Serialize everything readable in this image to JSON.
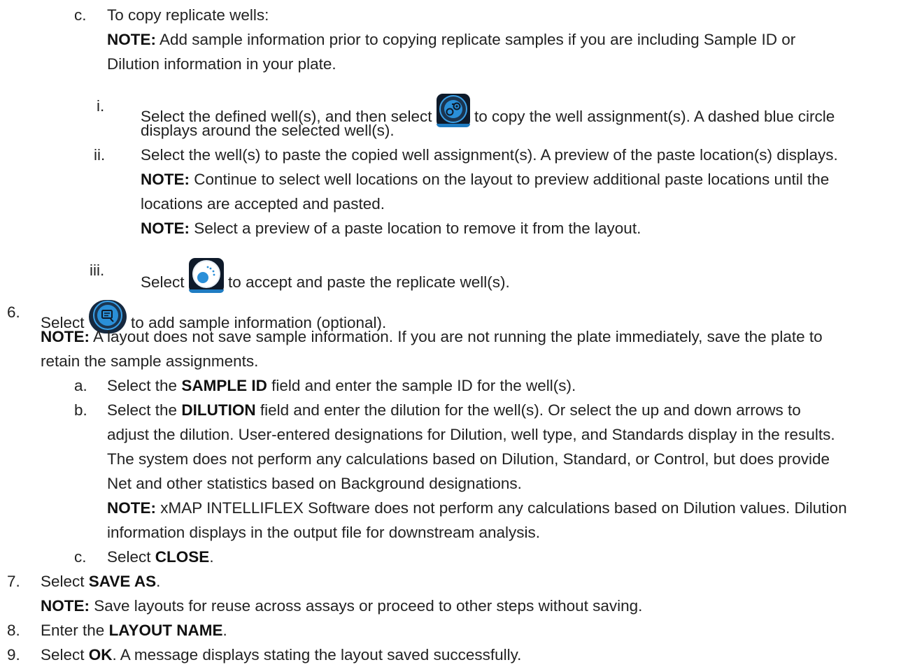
{
  "step_5c": {
    "marker": "c.",
    "title": "To copy replicate wells:",
    "note_label": "NOTE:",
    "note_text_1": " Add sample information prior to copying replicate samples if you are including Sample ID or",
    "note_text_2": "Dilution information in your plate.",
    "sub_i": {
      "marker": "i.",
      "text_before": "Select the defined well(s), and then select ",
      "icon": "copy-wells-icon",
      "text_after": " to copy the well assignment(s). A dashed blue circle",
      "text_line2": "displays around the selected well(s)."
    },
    "sub_ii": {
      "marker": "ii.",
      "text": "Select the well(s) to paste the copied well assignment(s). A preview of the paste location(s) displays.",
      "note1_label": "NOTE:",
      "note1_text_1": " Continue to select well locations on the layout to preview additional paste locations until the",
      "note1_text_2": "locations are accepted and pasted.",
      "note2_label": "NOTE:",
      "note2_text": " Select a preview of a paste location to remove it from the layout."
    },
    "sub_iii": {
      "marker": "iii.",
      "text_before": "Select ",
      "icon": "accept-paste-icon",
      "text_after": " to accept and paste the replicate well(s)."
    }
  },
  "step_6": {
    "marker": "6.",
    "text_before": "Select ",
    "icon": "sample-information-icon",
    "text_after": " to add sample information (optional).",
    "note_label": "NOTE:",
    "note_text_1": " A layout does not save sample information. If you are not running the plate immediately, save the plate to",
    "note_text_2": "retain the sample assignments.",
    "a": {
      "marker": "a.",
      "text_1": "Select the ",
      "bold": "SAMPLE ID",
      "text_2": " field and enter the sample ID for the well(s)."
    },
    "b": {
      "marker": "b.",
      "text_1": "Select the ",
      "bold": "DILUTION",
      "text_2": " field and enter the dilution for the well(s). Or select the up and down arrows to",
      "line2": "adjust the dilution. User-entered designations for Dilution, well type, and Standards display in the results.",
      "line3": "The system does not perform any calculations based on Dilution, Standard, or Control, but does provide",
      "line4": "Net and other statistics based on Background designations.",
      "note_label": "NOTE:",
      "note_text_1": " xMAP INTELLIFLEX Software does not perform any calculations based on Dilution values. Dilution",
      "note_text_2": "information displays in the output file for downstream analysis."
    },
    "c": {
      "marker": "c.",
      "text_1": "Select ",
      "bold": "CLOSE",
      "text_2": "."
    }
  },
  "step_7": {
    "marker": "7.",
    "text_1": "Select ",
    "bold": "SAVE AS",
    "text_2": ".",
    "note_label": "NOTE:",
    "note_text": " Save layouts for reuse across assays or proceed to other steps without saving."
  },
  "step_8": {
    "marker": "8.",
    "text_1": "Enter the ",
    "bold": "LAYOUT NAME",
    "text_2": "."
  },
  "step_9": {
    "marker": "9.",
    "text_1": "Select ",
    "bold": "OK",
    "text_2": ". A message displays stating the layout saved successfully."
  },
  "colors": {
    "icon_bg": "#0e1a2a",
    "icon_accent": "#2a8fd8",
    "text": "#222222"
  }
}
